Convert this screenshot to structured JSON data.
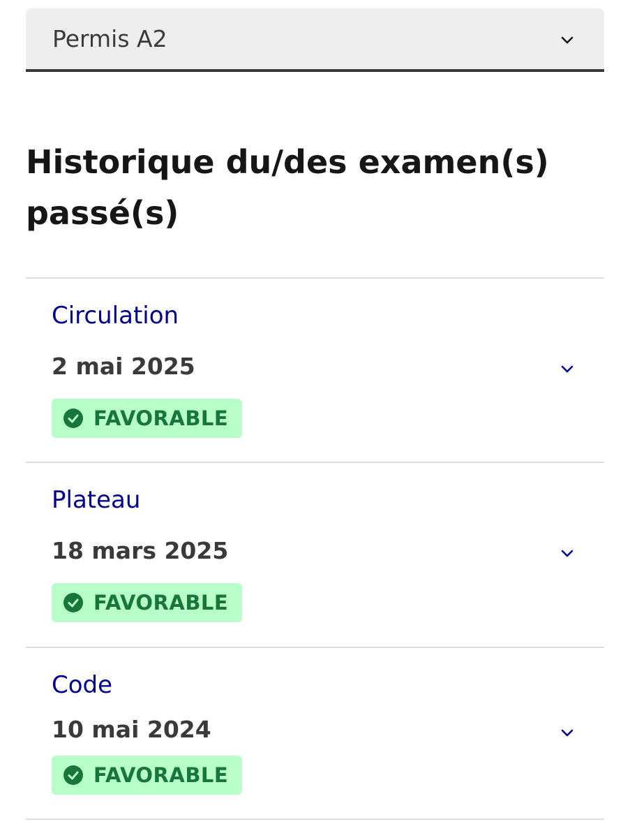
{
  "select": {
    "value": "Permis A2"
  },
  "page": {
    "title": "Historique du/des examen(s) passé(s)"
  },
  "exams": [
    {
      "name": "Circulation",
      "date": "2 mai 2025",
      "status": "FAVORABLE"
    },
    {
      "name": "Plateau",
      "date": "18 mars 2025",
      "status": "FAVORABLE"
    },
    {
      "name": "Code",
      "date": "10 mai 2024",
      "status": "FAVORABLE"
    }
  ],
  "icons": {
    "select_chevron": "chevron-down-icon",
    "exam_chevron": "chevron-down-icon",
    "status": "check-circle-icon"
  },
  "colors": {
    "accent_blue": "#000091",
    "success_text": "#18753c",
    "success_bg": "#b8fec9",
    "select_bg": "#eeeeee",
    "select_border": "#3a3a3a"
  }
}
